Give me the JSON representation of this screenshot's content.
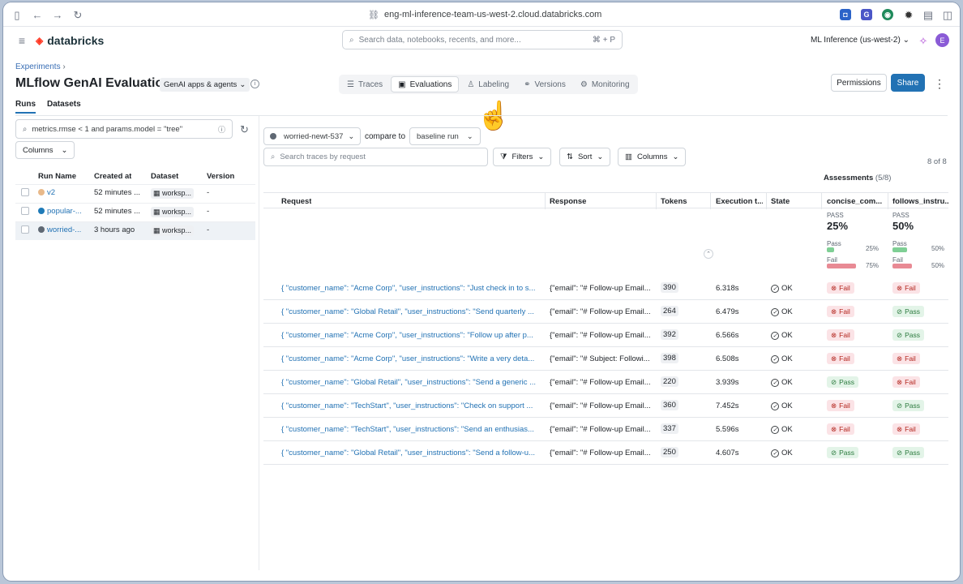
{
  "browser": {
    "url": "eng-ml-inference-team-us-west-2.cloud.databricks.com"
  },
  "header": {
    "brand": "databricks",
    "search_placeholder": "Search data, notebooks, recents, and more...",
    "search_shortcut": "⌘ + P",
    "workspace": "ML Inference (us-west-2)",
    "avatar_initial": "E"
  },
  "page": {
    "breadcrumb": "Experiments",
    "title": "MLflow GenAI Evaluation",
    "type_dropdown": "GenAI apps & agents",
    "tabs": [
      {
        "label": "Traces",
        "icon": "list-icon"
      },
      {
        "label": "Evaluations",
        "icon": "evaluation-icon",
        "active": true
      },
      {
        "label": "Labeling",
        "icon": "user-icon"
      },
      {
        "label": "Versions",
        "icon": "versions-icon"
      },
      {
        "label": "Monitoring",
        "icon": "gear-icon"
      }
    ],
    "permissions_label": "Permissions",
    "share_label": "Share"
  },
  "left_panel": {
    "tabs": [
      "Runs",
      "Datasets"
    ],
    "search_value": "metrics.rmse < 1 and params.model = \"tree\"",
    "columns_label": "Columns",
    "headers": [
      "Run Name",
      "Created at",
      "Dataset",
      "Version"
    ],
    "runs": [
      {
        "name": "v2",
        "created": "52 minutes ...",
        "dataset": "worksp...",
        "version": "-",
        "color": "#e8b98a"
      },
      {
        "name": "popular-...",
        "created": "52 minutes ...",
        "dataset": "worksp...",
        "version": "-",
        "color": "#1f7bb8"
      },
      {
        "name": "worried-...",
        "created": "3 hours ago",
        "dataset": "worksp...",
        "version": "-",
        "color": "#5f6873"
      }
    ]
  },
  "main": {
    "run_selected": "worried-newt-537",
    "compare_to_label": "compare to",
    "baseline": "baseline run",
    "search_placeholder": "Search traces by request",
    "filters_label": "Filters",
    "sort_label": "Sort",
    "columns_label": "Columns",
    "count": "8 of 8",
    "assessments_label": "Assessments",
    "assessments_count": "(5/8)",
    "headers": [
      "Request",
      "Response",
      "Tokens",
      "Execution t...",
      "State",
      "concise_com...",
      "follows_instru..."
    ],
    "summary": [
      {
        "pass_label": "PASS",
        "value": "25%",
        "pass": "Pass",
        "pass_pct": "25%",
        "fail": "Fail",
        "fail_pct": "75%",
        "pass_frac": 0.25,
        "fail_frac": 0.75
      },
      {
        "pass_label": "PASS",
        "value": "50%",
        "pass": "Pass",
        "pass_pct": "50%",
        "fail": "Fail",
        "fail_pct": "50%",
        "pass_frac": 0.5,
        "fail_frac": 0.5
      }
    ],
    "rows": [
      {
        "request": "{ \"customer_name\": \"Acme Corp\", \"user_instructions\": \"Just check in to s...",
        "response": "{\"email\": \"# Follow-up Email...",
        "tokens": "390",
        "time": "6.318s",
        "state": "OK",
        "a1": "Fail",
        "a2": "Fail"
      },
      {
        "request": "{ \"customer_name\": \"Global Retail\", \"user_instructions\": \"Send quarterly ...",
        "response": "{\"email\": \"# Follow-up Email...",
        "tokens": "264",
        "time": "6.479s",
        "state": "OK",
        "a1": "Fail",
        "a2": "Pass"
      },
      {
        "request": "{ \"customer_name\": \"Acme Corp\", \"user_instructions\": \"Follow up after p...",
        "response": "{\"email\": \"# Follow-up Email...",
        "tokens": "392",
        "time": "6.566s",
        "state": "OK",
        "a1": "Fail",
        "a2": "Pass"
      },
      {
        "request": "{ \"customer_name\": \"Acme Corp\", \"user_instructions\": \"Write a very deta...",
        "response": "{\"email\": \"# Subject: Followi...",
        "tokens": "398",
        "time": "6.508s",
        "state": "OK",
        "a1": "Fail",
        "a2": "Fail"
      },
      {
        "request": "{ \"customer_name\": \"Global Retail\", \"user_instructions\": \"Send a generic ...",
        "response": "{\"email\": \"# Follow-up Email...",
        "tokens": "220",
        "time": "3.939s",
        "state": "OK",
        "a1": "Pass",
        "a2": "Fail"
      },
      {
        "request": "{ \"customer_name\": \"TechStart\", \"user_instructions\": \"Check on support ...",
        "response": "{\"email\": \"# Follow-up Email...",
        "tokens": "360",
        "time": "7.452s",
        "state": "OK",
        "a1": "Fail",
        "a2": "Pass"
      },
      {
        "request": "{ \"customer_name\": \"TechStart\", \"user_instructions\": \"Send an enthusias...",
        "response": "{\"email\": \"# Follow-up Email...",
        "tokens": "337",
        "time": "5.596s",
        "state": "OK",
        "a1": "Fail",
        "a2": "Fail"
      },
      {
        "request": "{ \"customer_name\": \"Global Retail\", \"user_instructions\": \"Send a follow-u...",
        "response": "{\"email\": \"# Follow-up Email...",
        "tokens": "250",
        "time": "4.607s",
        "state": "OK",
        "a1": "Pass",
        "a2": "Pass"
      }
    ]
  },
  "colors": {
    "accent": "#2272b4",
    "fail_bg": "#fbe3e6",
    "pass_bg": "#e3f4e8",
    "fail_bar": "#e88a94",
    "pass_bar": "#7fcf95"
  }
}
